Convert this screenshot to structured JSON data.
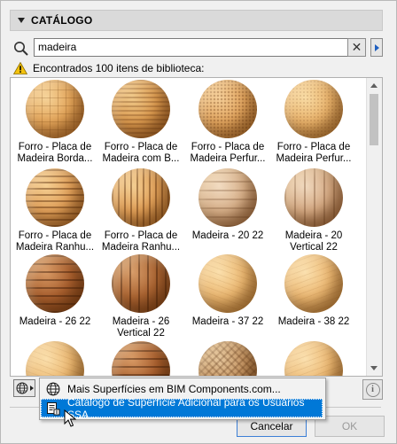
{
  "catalog": {
    "title": "CATÁLOGO"
  },
  "search": {
    "value": "madeira",
    "clear_label": "✕"
  },
  "warning": {
    "text": "Encontrados 100 itens de biblioteca:"
  },
  "items": [
    {
      "label1": "Forro - Placa de",
      "label2": "Madeira Borda...",
      "tex": "pattern-grid"
    },
    {
      "label1": "Forro - Placa de",
      "label2": "Madeira com B...",
      "tex": "pattern-perf"
    },
    {
      "label1": "Forro - Placa de",
      "label2": "Madeira Perfur...",
      "tex": "pattern-dots"
    },
    {
      "label1": "Forro - Placa de",
      "label2": "Madeira Perfur...",
      "tex": "pattern-smooth"
    },
    {
      "label1": "Forro - Placa de",
      "label2": "Madeira Ranhu...",
      "tex": "pattern-slots"
    },
    {
      "label1": "Forro - Placa de",
      "label2": "Madeira Ranhu...",
      "tex": "pattern-slots2"
    },
    {
      "label1": "Madeira - 20 22",
      "label2": "",
      "tex": "pattern-stripes-light"
    },
    {
      "label1": "Madeira - 20",
      "label2": "Vertical 22",
      "tex": "pattern-vert-light"
    },
    {
      "label1": "Madeira - 26 22",
      "label2": "",
      "tex": "pattern-stripes-dark"
    },
    {
      "label1": "Madeira - 26",
      "label2": "Vertical 22",
      "tex": "pattern-vert-dark"
    },
    {
      "label1": "Madeira - 37 22",
      "label2": "",
      "tex": "pattern-plain-light"
    },
    {
      "label1": "Madeira - 38 22",
      "label2": "",
      "tex": "pattern-plain-light2"
    },
    {
      "label1": "",
      "label2": "",
      "tex": "pattern-plain-light"
    },
    {
      "label1": "",
      "label2": "",
      "tex": "pattern-stripes-dark"
    },
    {
      "label1": "",
      "label2": "",
      "tex": "pattern-weave"
    },
    {
      "label1": "",
      "label2": "",
      "tex": "pattern-plain-light2"
    }
  ],
  "menu": {
    "item1": "Mais Superfícies em BIM Components.com...",
    "item2": "Catálogo de Superfície Adicional para os Usuários SSA..."
  },
  "buttons": {
    "cancel": "Cancelar",
    "ok": "OK"
  },
  "colors": {
    "accent": "#0078d7",
    "wood": "#e0a860"
  }
}
